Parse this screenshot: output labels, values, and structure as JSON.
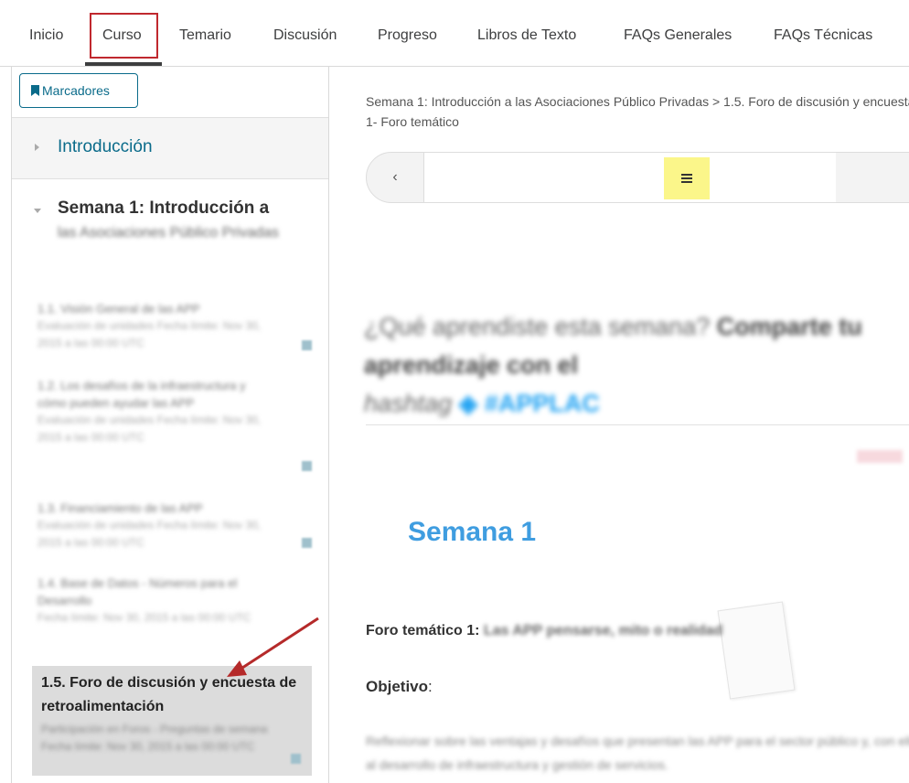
{
  "nav": {
    "tabs": [
      {
        "label": "Inicio"
      },
      {
        "label": "Curso"
      },
      {
        "label": "Temario"
      },
      {
        "label": "Discusión"
      },
      {
        "label": "Progreso"
      },
      {
        "label": "Libros de Texto"
      },
      {
        "label": "FAQs Generales"
      },
      {
        "label": "FAQs Técnicas"
      }
    ],
    "active": "Curso"
  },
  "sidebar": {
    "bookmarks_label": "Marcadores",
    "intro_label": "Introducción",
    "week_title": "Semana 1: Introducción a",
    "week_title_blur": "las Asociaciones Público Privadas",
    "subsections": [
      {
        "title": "1.1. Visión General de las APP",
        "meta": "Evaluación de unidades Fecha límite: Nov 30, 2015 a las 00:00 UTC"
      },
      {
        "title": "1.2. Los desafíos de la infraestructura y cómo pueden ayudar las APP",
        "meta": "Evaluación de unidades Fecha límite: Nov 30, 2015 a las 00:00 UTC"
      },
      {
        "title": "1.3. Financiamiento de las APP",
        "meta": "Evaluación de unidades Fecha límite: Nov 30, 2015 a las 00:00 UTC"
      },
      {
        "title": "1.4. Base de Datos - Números para el Desarrollo",
        "meta": "Fecha límite: Nov 30, 2015 a las 00:00 UTC"
      }
    ],
    "active_item": {
      "title": "1.5. Foro de discusión y encuesta de retroalimentación",
      "meta": "Participación en Foros - Preguntas de semana Fecha límite: Nov 30, 2015 a las 00:00 UTC"
    }
  },
  "main": {
    "breadcrumb_line1": "Semana 1: Introducción a las Asociaciones Público Privadas > 1.5. Foro de discusión y encuesta de retroalimentación >",
    "breadcrumb_line2": "1- Foro temático",
    "promo_text": "¿Qué aprendiste esta semana?",
    "promo_bold": "Comparte tu aprendizaje con el",
    "promo_hashtag_label": "hashtag",
    "promo_hashtag": "#APPLAC",
    "week_heading": "Semana 1",
    "foro_label": "Foro temático 1:",
    "foro_blur": "Las APP pensarse, mito o realidad",
    "objetivo_label": "Objetivo",
    "objetivo_colon": ":",
    "body": "Reflexionar sobre las ventajas y desafíos que presentan las APP para el sector público y, con ello, al desarrollo de infraestructura y gestión de servicios."
  },
  "colors": {
    "accent": "#0a6b8a",
    "highlight_border": "#c0282e",
    "week_heading": "#3f9de0",
    "seq_icon_bg": "#fbf68a"
  }
}
